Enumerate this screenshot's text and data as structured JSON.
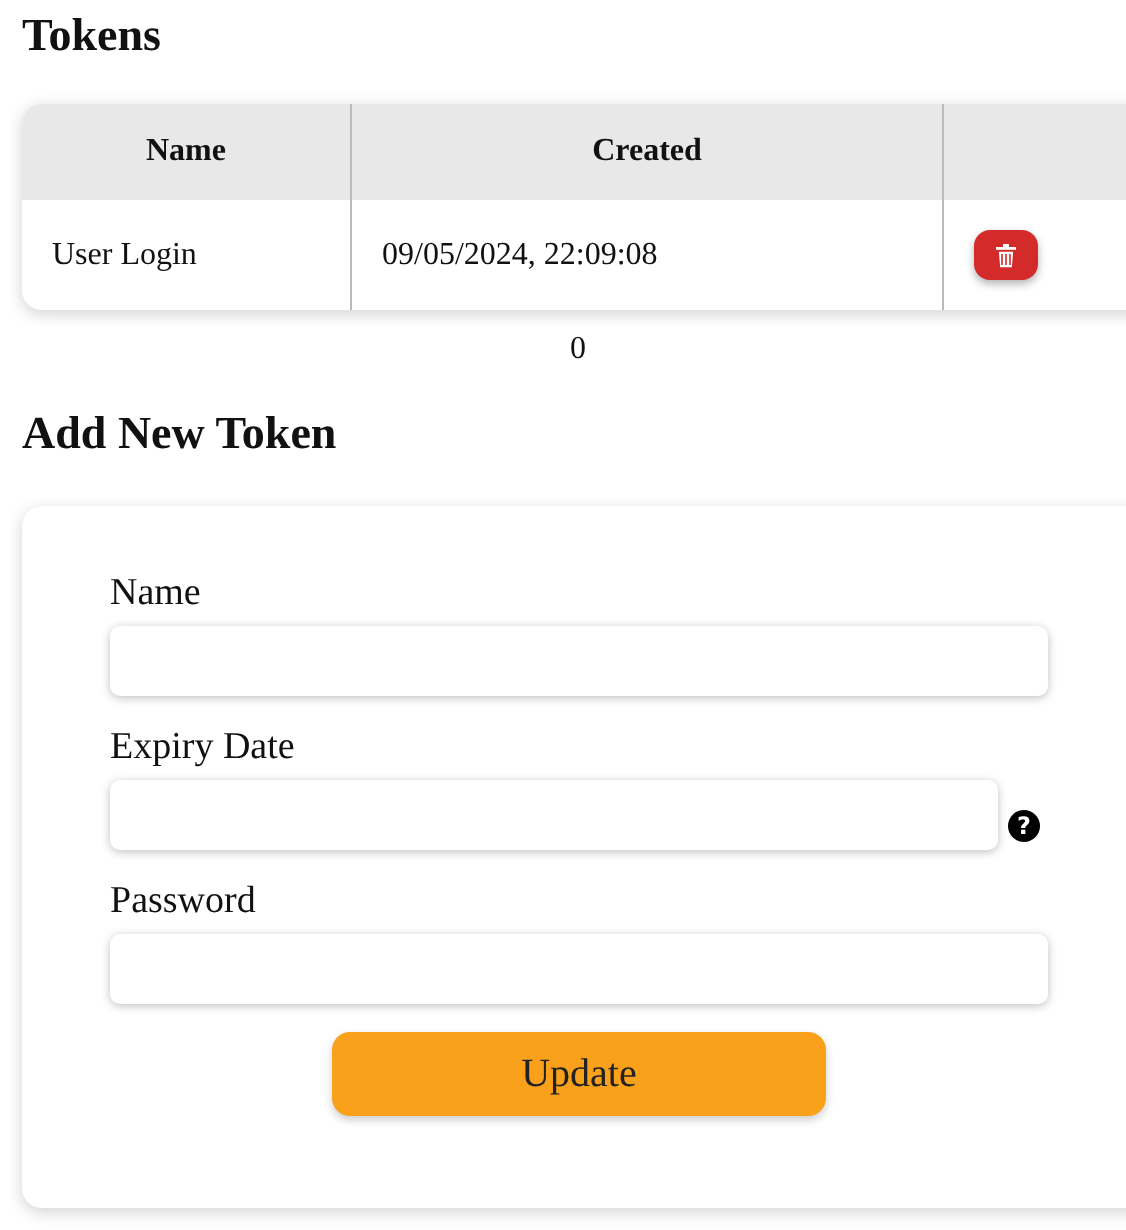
{
  "title": "Tokens",
  "table": {
    "columns": [
      "Name",
      "Created",
      ""
    ],
    "rows": [
      {
        "name": "User Login",
        "created": "09/05/2024, 22:09:08"
      }
    ]
  },
  "count": "0",
  "form_title": "Add New Token",
  "fields": [
    {
      "label": "Name",
      "help": false
    },
    {
      "label": "Expiry Date",
      "help": true
    },
    {
      "label": "Password",
      "help": false
    }
  ],
  "help_icon": "?",
  "button": "Update"
}
